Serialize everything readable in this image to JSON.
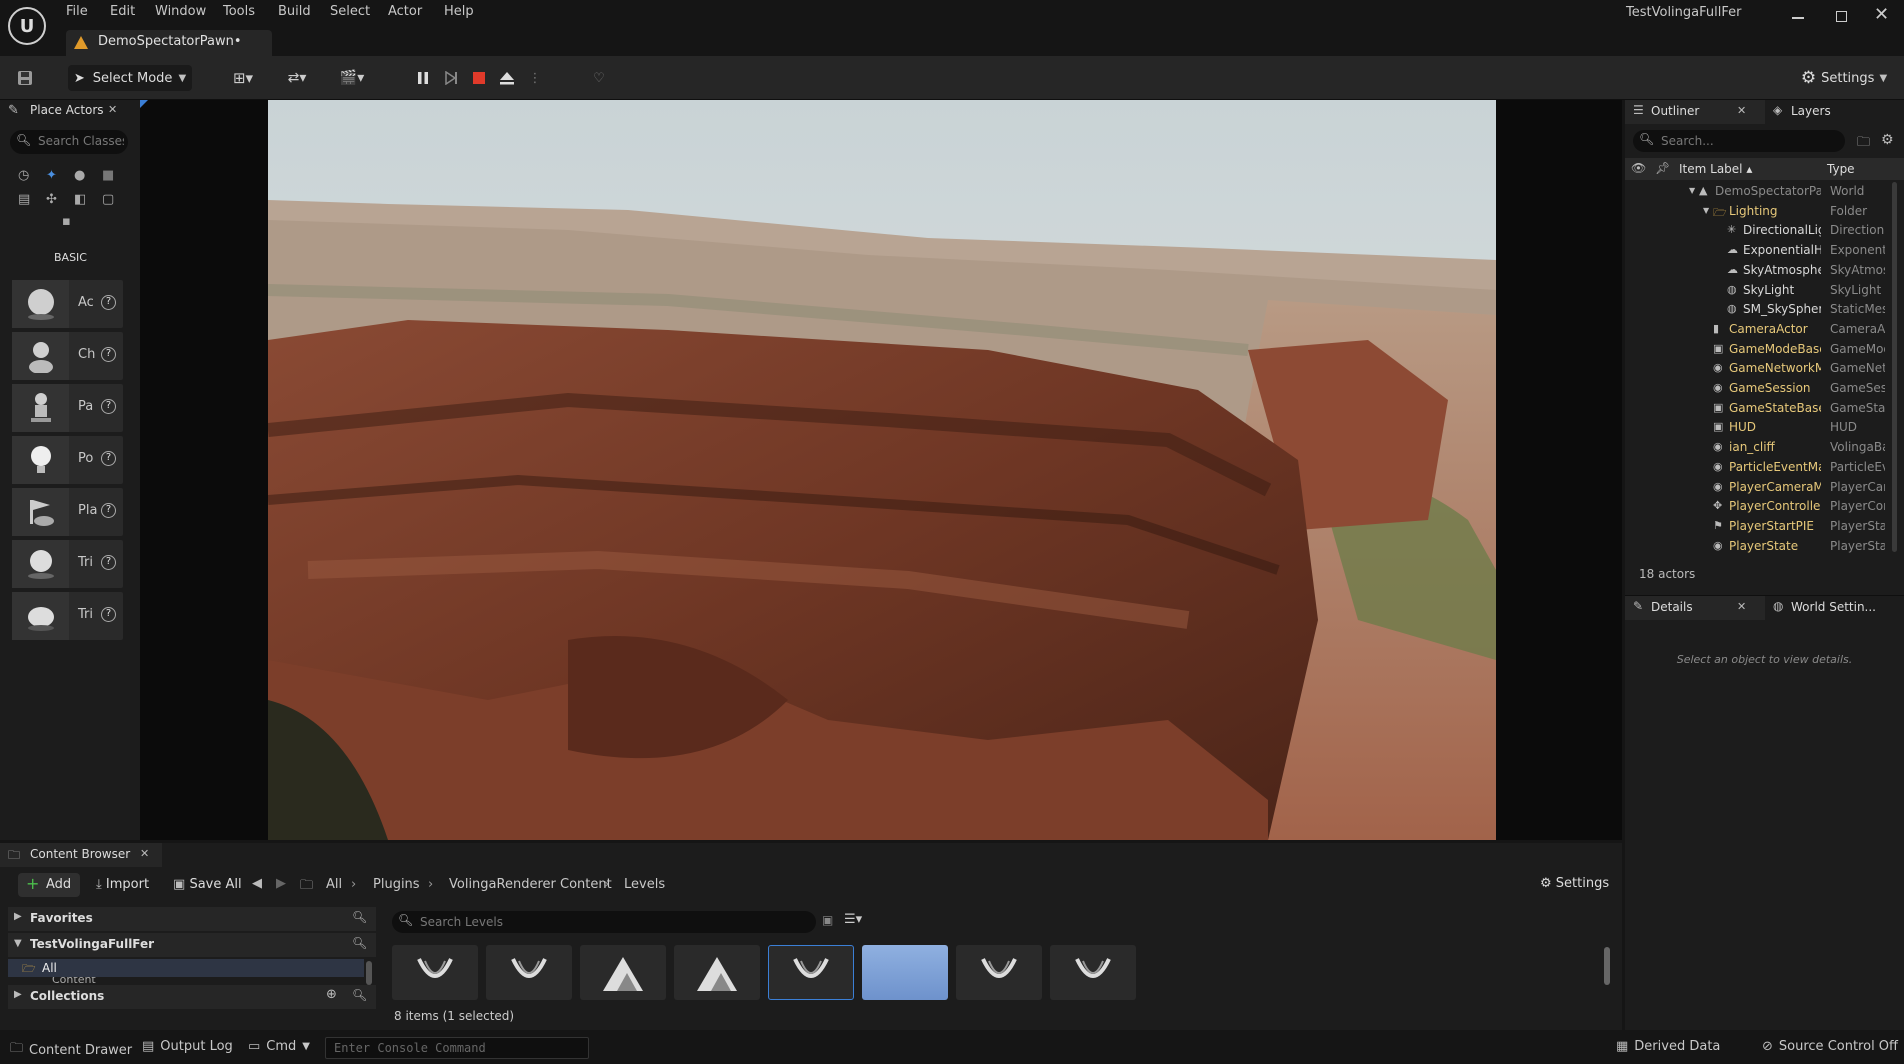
{
  "app": {
    "window_title": "TestVolingaFullFer",
    "tab_title": "DemoSpectatorPawn•"
  },
  "menu": [
    "File",
    "Edit",
    "Window",
    "Tools",
    "Build",
    "Select",
    "Actor",
    "Help"
  ],
  "toolbar": {
    "select_mode": "Select Mode",
    "settings": "Settings"
  },
  "place_actors": {
    "tab": "Place Actors",
    "search_placeholder": "Search Classes",
    "category": "BASIC",
    "items": [
      {
        "label": "Ac"
      },
      {
        "label": "Ch"
      },
      {
        "label": "Pa"
      },
      {
        "label": "Po"
      },
      {
        "label": "Pla"
      },
      {
        "label": "Tri"
      },
      {
        "label": "Tri"
      }
    ]
  },
  "outliner": {
    "tab": "Outliner",
    "layers_tab": "Layers",
    "search_placeholder": "Search...",
    "col_label": "Item Label ▴",
    "col_type": "Type",
    "rows": [
      {
        "label": "DemoSpectatorPawn",
        "type": "World"
      },
      {
        "label": "Lighting",
        "type": "Folder"
      },
      {
        "label": "DirectionalLight",
        "type": "DirectionalLight"
      },
      {
        "label": "ExponentialHeightFog",
        "type": "ExponentialHeightFog"
      },
      {
        "label": "SkyAtmosphere",
        "type": "SkyAtmosphere"
      },
      {
        "label": "SkyLight",
        "type": "SkyLight"
      },
      {
        "label": "SM_SkySphere",
        "type": "StaticMeshActor"
      },
      {
        "label": "CameraActor",
        "type": "CameraActor"
      },
      {
        "label": "GameModeBase",
        "type": "GameModeBase"
      },
      {
        "label": "GameNetworkManager",
        "type": "GameNetworkManager"
      },
      {
        "label": "GameSession",
        "type": "GameSession"
      },
      {
        "label": "GameStateBase",
        "type": "GameStateBase"
      },
      {
        "label": "HUD",
        "type": "HUD"
      },
      {
        "label": "ian_cliff",
        "type": "VolingaBaseActor"
      },
      {
        "label": "ParticleEventManager",
        "type": "ParticleEventManager"
      },
      {
        "label": "PlayerCameraManager",
        "type": "PlayerCameraManager"
      },
      {
        "label": "PlayerController",
        "type": "PlayerController"
      },
      {
        "label": "PlayerStartPIE",
        "type": "PlayerStart"
      },
      {
        "label": "PlayerState",
        "type": "PlayerState"
      }
    ],
    "count": "18 actors"
  },
  "details": {
    "tab": "Details",
    "world_tab": "World Settin...",
    "empty": "Select an object to view details."
  },
  "content_browser": {
    "tab": "Content Browser",
    "add": "Add",
    "import": "Import",
    "save_all": "Save All",
    "crumbs": [
      "All",
      "Plugins",
      "VolingaRenderer Content",
      "Levels"
    ],
    "settings": "Settings",
    "favorites": "Favorites",
    "project": "TestVolingaFullFer",
    "all": "All",
    "content": "Content",
    "collections": "Collections",
    "search_placeholder": "Search Levels",
    "status": "8 items (1 selected)"
  },
  "statusbar": {
    "drawer": "Content Drawer",
    "output": "Output Log",
    "cmd": "Cmd",
    "console_placeholder": "Enter Console Command",
    "derived": "Derived Data",
    "source": "Source Control Off"
  }
}
